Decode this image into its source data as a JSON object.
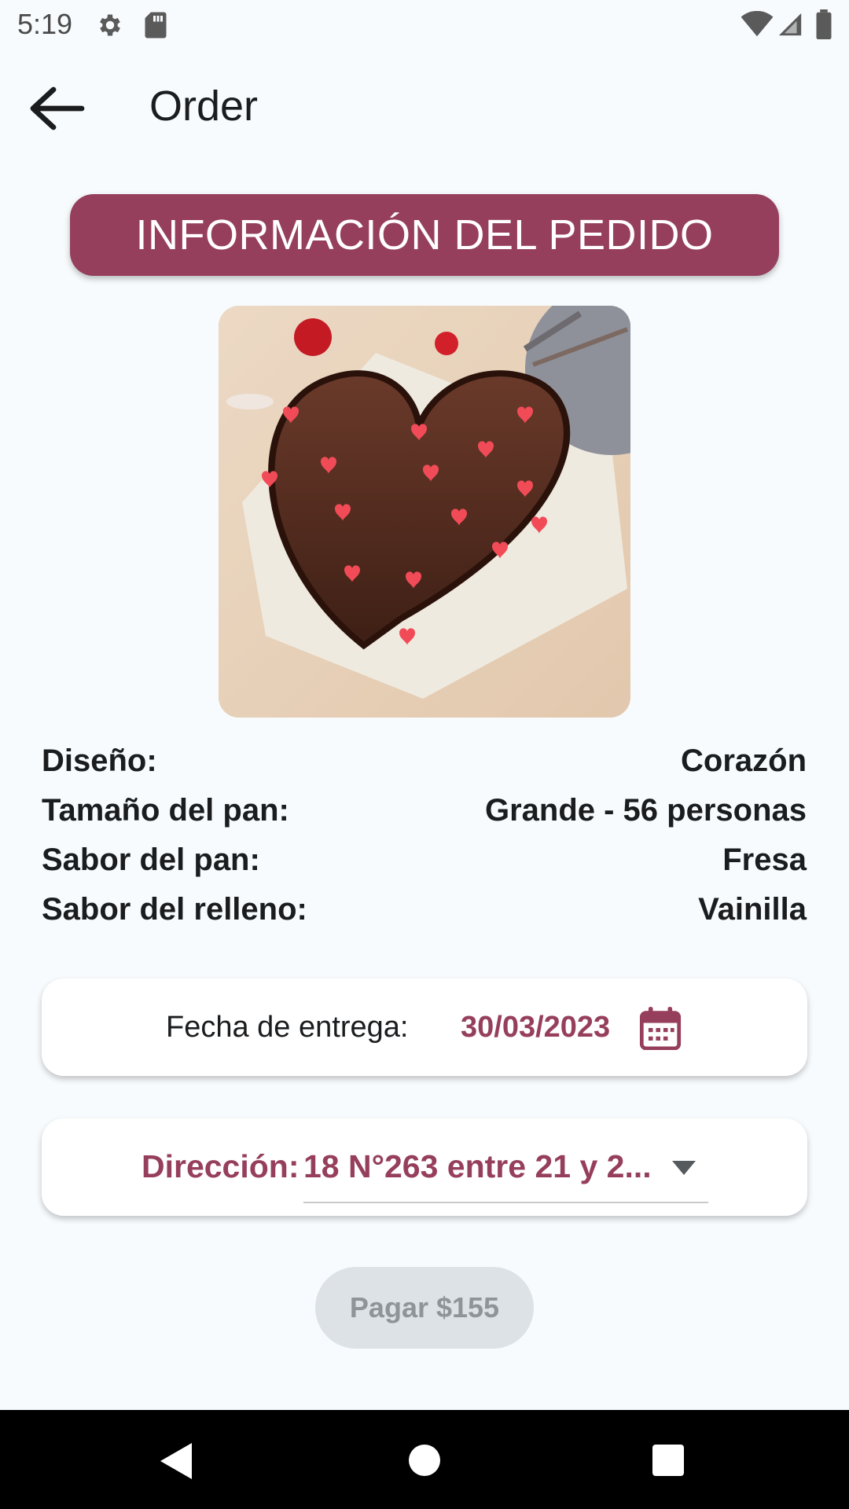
{
  "status_bar": {
    "time": "5:19",
    "icons": [
      "gear-icon",
      "sd-card-icon",
      "wifi-icon",
      "signal-icon",
      "battery-icon"
    ]
  },
  "app_bar": {
    "title": "Order",
    "back_icon": "arrow-back-icon"
  },
  "header": {
    "title": "INFORMACIÓN DEL PEDIDO"
  },
  "product_image": {
    "subject": "heart-cake"
  },
  "details": [
    {
      "label": "Diseño:",
      "value": "Corazón"
    },
    {
      "label": "Tamaño del pan:",
      "value": "Grande - 56 personas"
    },
    {
      "label": "Sabor del pan:",
      "value": "Fresa"
    },
    {
      "label": "Sabor del relleno:",
      "value": "Vainilla"
    }
  ],
  "delivery": {
    "label": "Fecha de entrega:",
    "date": "30/03/2023",
    "icon": "calendar-icon"
  },
  "address": {
    "label": "Dirección:",
    "selected": "18 N°263 entre 21 y 2...",
    "icon": "chevron-down-icon"
  },
  "pay_button": {
    "label": "Pagar $155",
    "enabled": false
  },
  "colors": {
    "accent": "#963f5c",
    "background": "#f7fbfd",
    "disabled_button": "#dce2e6",
    "disabled_text": "#8e9498"
  },
  "nav_bar": {
    "icons": [
      "nav-back-icon",
      "nav-home-icon",
      "nav-recents-icon"
    ]
  }
}
